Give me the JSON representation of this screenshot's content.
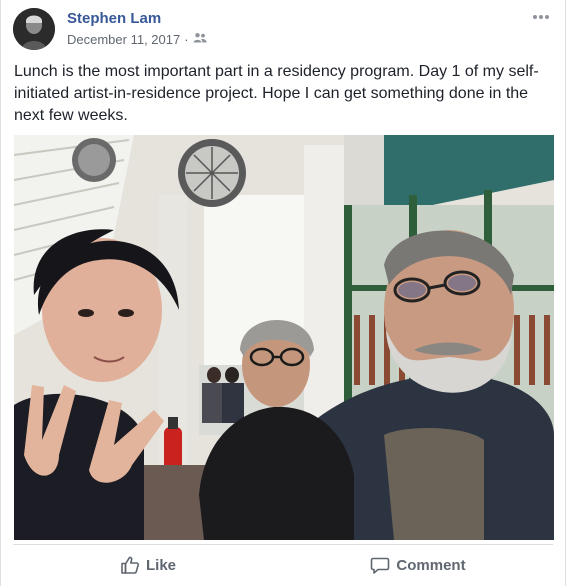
{
  "post": {
    "author": "Stephen Lam",
    "date": "December 11, 2017",
    "separator": "·",
    "privacy_icon": "friends-icon",
    "more_icon": "more-options-icon",
    "text": "Lunch is the most important part in a residency program. Day 1 of my self-initiated artist-in-residence project. Hope I can get something done in the next few weeks."
  },
  "actions": {
    "like_label": "Like",
    "like_icon": "thumbs-up-icon",
    "comment_label": "Comment",
    "comment_icon": "speech-bubble-icon"
  },
  "colors": {
    "author_link": "#385898",
    "meta_text": "#616770",
    "action_text": "#606770",
    "divider": "#dadde1"
  }
}
